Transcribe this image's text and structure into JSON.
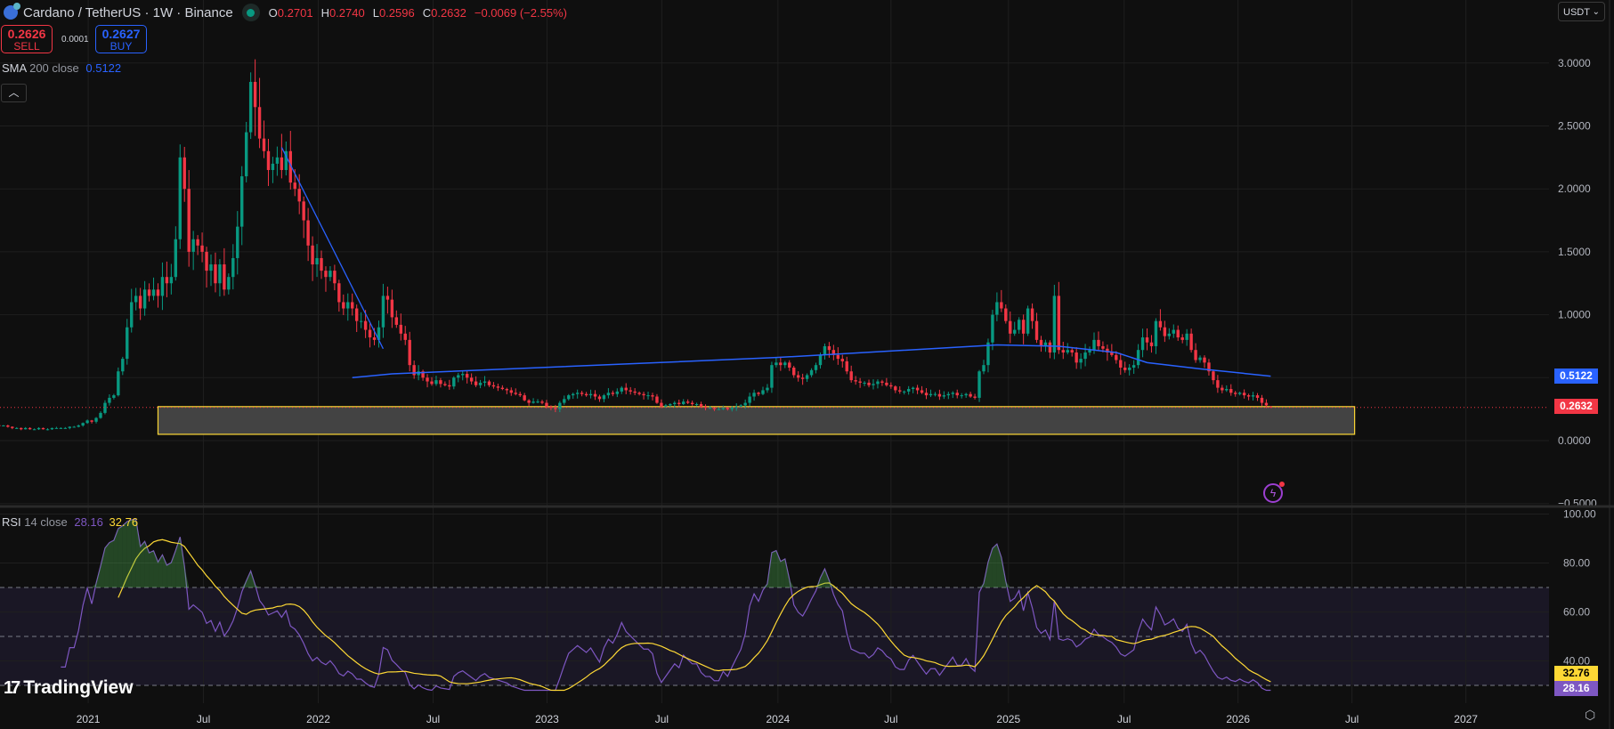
{
  "header": {
    "title": "Cardano / TetherUS · 1W · Binance",
    "open_label": "O",
    "open": "0.2701",
    "high_label": "H",
    "high": "0.2740",
    "low_label": "L",
    "low": "0.2596",
    "close_label": "C",
    "close": "0.2632",
    "change": "−0.0069 (−2.55%)"
  },
  "trade": {
    "sell_price": "0.2626",
    "sell_label": "SELL",
    "spread": "0.0001",
    "buy_price": "0.2627",
    "buy_label": "BUY"
  },
  "currency_selector": "USDT",
  "sma_legend": {
    "name": "SMA",
    "params": "200 close",
    "value": "0.5122"
  },
  "rsi_legend": {
    "name": "RSI",
    "params": "14 close",
    "value": "28.16",
    "ma_value": "32.76"
  },
  "logo_text": "TradingView",
  "colors": {
    "up": "#089981",
    "down": "#f23645",
    "sma": "#2962ff",
    "rsi": "#7e57c2",
    "rsi_ma": "#fdd835",
    "zone": "#fdd835"
  },
  "chart_data": [
    {
      "type": "candlestick",
      "title": "Cardano / TetherUS · 1W · Binance",
      "x_unit": "week index (0 = week of 2020-08-17)",
      "price_ticks": [
        "3.0000",
        "2.5000",
        "2.0000",
        "1.5000",
        "1.0000",
        "0.5000",
        "0.0000",
        "−0.5000"
      ],
      "price_tick_values": [
        3,
        2.5,
        2,
        1.5,
        1,
        0.5,
        0,
        -0.5
      ],
      "ylim": [
        -0.5,
        3.5
      ],
      "time_ticks": [
        {
          "label": "2021",
          "week": 20.2
        },
        {
          "label": "Jul",
          "week": 46.3
        },
        {
          "label": "2022",
          "week": 72.3
        },
        {
          "label": "Jul",
          "week": 98.3
        },
        {
          "label": "2023",
          "week": 124.1
        },
        {
          "label": "Jul",
          "week": 150.1
        },
        {
          "label": "2024",
          "week": 176.4
        },
        {
          "label": "Jul",
          "week": 202.0
        },
        {
          "label": "2025",
          "week": 228.6
        },
        {
          "label": "Jul",
          "week": 254.8
        },
        {
          "label": "2026",
          "week": 280.6
        },
        {
          "label": "Jul",
          "week": 306.4
        },
        {
          "label": "2027",
          "week": 332.2
        }
      ],
      "weekly_close": [
        0.12,
        0.12,
        0.11,
        0.1,
        0.1,
        0.09,
        0.1,
        0.09,
        0.09,
        0.1,
        0.09,
        0.09,
        0.1,
        0.1,
        0.1,
        0.1,
        0.11,
        0.11,
        0.12,
        0.14,
        0.16,
        0.15,
        0.18,
        0.22,
        0.3,
        0.34,
        0.36,
        0.55,
        0.65,
        0.9,
        1.1,
        1.15,
        1.05,
        1.2,
        1.15,
        1.2,
        1.15,
        1.3,
        1.25,
        1.3,
        1.6,
        2.25,
        2.0,
        1.5,
        1.6,
        1.55,
        1.5,
        1.35,
        1.4,
        1.25,
        1.4,
        1.2,
        1.3,
        1.45,
        1.7,
        2.1,
        2.45,
        2.85,
        2.65,
        2.4,
        2.3,
        2.15,
        2.2,
        2.25,
        2.15,
        2.3,
        2.05,
        2.0,
        1.9,
        1.75,
        1.55,
        1.4,
        1.45,
        1.35,
        1.3,
        1.35,
        1.25,
        1.1,
        1.05,
        1.1,
        1.05,
        0.95,
        0.95,
        0.88,
        0.82,
        0.8,
        0.9,
        1.15,
        1.12,
        0.98,
        0.92,
        0.85,
        0.8,
        0.6,
        0.52,
        0.55,
        0.5,
        0.47,
        0.45,
        0.48,
        0.45,
        0.44,
        0.43,
        0.5,
        0.52,
        0.53,
        0.5,
        0.47,
        0.44,
        0.46,
        0.47,
        0.44,
        0.43,
        0.42,
        0.41,
        0.4,
        0.38,
        0.37,
        0.36,
        0.32,
        0.3,
        0.31,
        0.31,
        0.3,
        0.27,
        0.26,
        0.25,
        0.3,
        0.33,
        0.36,
        0.37,
        0.38,
        0.37,
        0.36,
        0.37,
        0.35,
        0.33,
        0.36,
        0.38,
        0.37,
        0.39,
        0.42,
        0.4,
        0.39,
        0.38,
        0.37,
        0.36,
        0.36,
        0.35,
        0.3,
        0.27,
        0.28,
        0.29,
        0.3,
        0.29,
        0.31,
        0.3,
        0.29,
        0.29,
        0.27,
        0.26,
        0.26,
        0.25,
        0.25,
        0.26,
        0.25,
        0.26,
        0.27,
        0.28,
        0.3,
        0.35,
        0.38,
        0.37,
        0.4,
        0.42,
        0.6,
        0.62,
        0.6,
        0.62,
        0.58,
        0.52,
        0.5,
        0.49,
        0.52,
        0.56,
        0.6,
        0.68,
        0.75,
        0.72,
        0.68,
        0.65,
        0.63,
        0.55,
        0.48,
        0.47,
        0.46,
        0.46,
        0.44,
        0.45,
        0.47,
        0.46,
        0.44,
        0.43,
        0.4,
        0.39,
        0.39,
        0.41,
        0.42,
        0.4,
        0.38,
        0.36,
        0.37,
        0.37,
        0.35,
        0.36,
        0.37,
        0.38,
        0.36,
        0.36,
        0.37,
        0.35,
        0.34,
        0.55,
        0.6,
        0.78,
        1.0,
        1.1,
        1.05,
        0.95,
        0.85,
        0.88,
        0.96,
        0.85,
        1.05,
        0.95,
        0.8,
        0.75,
        0.78,
        0.7,
        1.15,
        0.72,
        0.7,
        0.72,
        0.7,
        0.62,
        0.65,
        0.7,
        0.72,
        0.8,
        0.75,
        0.73,
        0.7,
        0.68,
        0.64,
        0.58,
        0.56,
        0.58,
        0.6,
        0.72,
        0.82,
        0.78,
        0.75,
        0.95,
        0.9,
        0.83,
        0.85,
        0.88,
        0.82,
        0.8,
        0.85,
        0.72,
        0.64,
        0.66,
        0.62,
        0.55,
        0.48,
        0.42,
        0.4,
        0.41,
        0.38,
        0.37,
        0.38,
        0.36,
        0.35,
        0.36,
        0.34,
        0.3,
        0.28,
        0.2632
      ],
      "last_candle": {
        "open": 0.2701,
        "high": 0.274,
        "low": 0.2596,
        "close": 0.2632
      },
      "current_price": 0.2632,
      "sma200": {
        "label": "SMA 200 close",
        "value": 0.5122,
        "points": [
          {
            "week": 80,
            "value": 0.5
          },
          {
            "week": 89,
            "value": 0.53
          },
          {
            "week": 176,
            "value": 0.66
          },
          {
            "week": 226,
            "value": 0.76
          },
          {
            "week": 240,
            "value": 0.75
          },
          {
            "week": 253,
            "value": 0.7
          },
          {
            "week": 260,
            "value": 0.62
          },
          {
            "week": 272,
            "value": 0.57
          },
          {
            "week": 288,
            "value": 0.5122
          }
        ]
      },
      "trendline": {
        "from": {
          "week": 64,
          "price": 2.33
        },
        "to": {
          "week": 87,
          "price": 0.73
        }
      },
      "zone": {
        "from_week": 36,
        "to_week": 307,
        "top": 0.27,
        "bottom": 0.05
      }
    },
    {
      "type": "line",
      "title": "RSI 14 close",
      "ylim": [
        30,
        100
      ],
      "ticks": [
        "100.00",
        "80.00",
        "60.00",
        "40.00"
      ],
      "tick_values": [
        100,
        80,
        60,
        40
      ],
      "bands": {
        "upper": 70,
        "middle": 50,
        "lower": 30
      },
      "series": [
        {
          "name": "RSI",
          "last": 28.16
        },
        {
          "name": "RSI MA",
          "last": 32.76
        }
      ]
    }
  ]
}
